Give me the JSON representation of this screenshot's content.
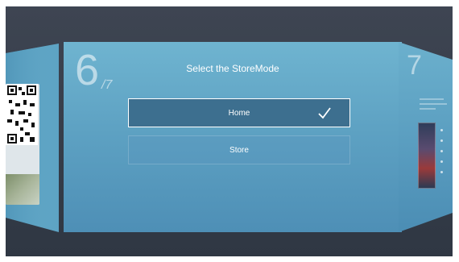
{
  "dialog": {
    "title": "Select the StoreMode",
    "page_current": "6",
    "page_total": "/7"
  },
  "options": [
    {
      "label": "Home",
      "selected": true
    },
    {
      "label": "Store",
      "selected": false
    }
  ],
  "next_panel": {
    "page_number": "7"
  },
  "colors": {
    "background": "#353c48",
    "panel_top": "#6fb4d0",
    "panel_bottom": "#4e8fb6",
    "selected_option": "#3d6f8f",
    "text": "#ffffff"
  }
}
